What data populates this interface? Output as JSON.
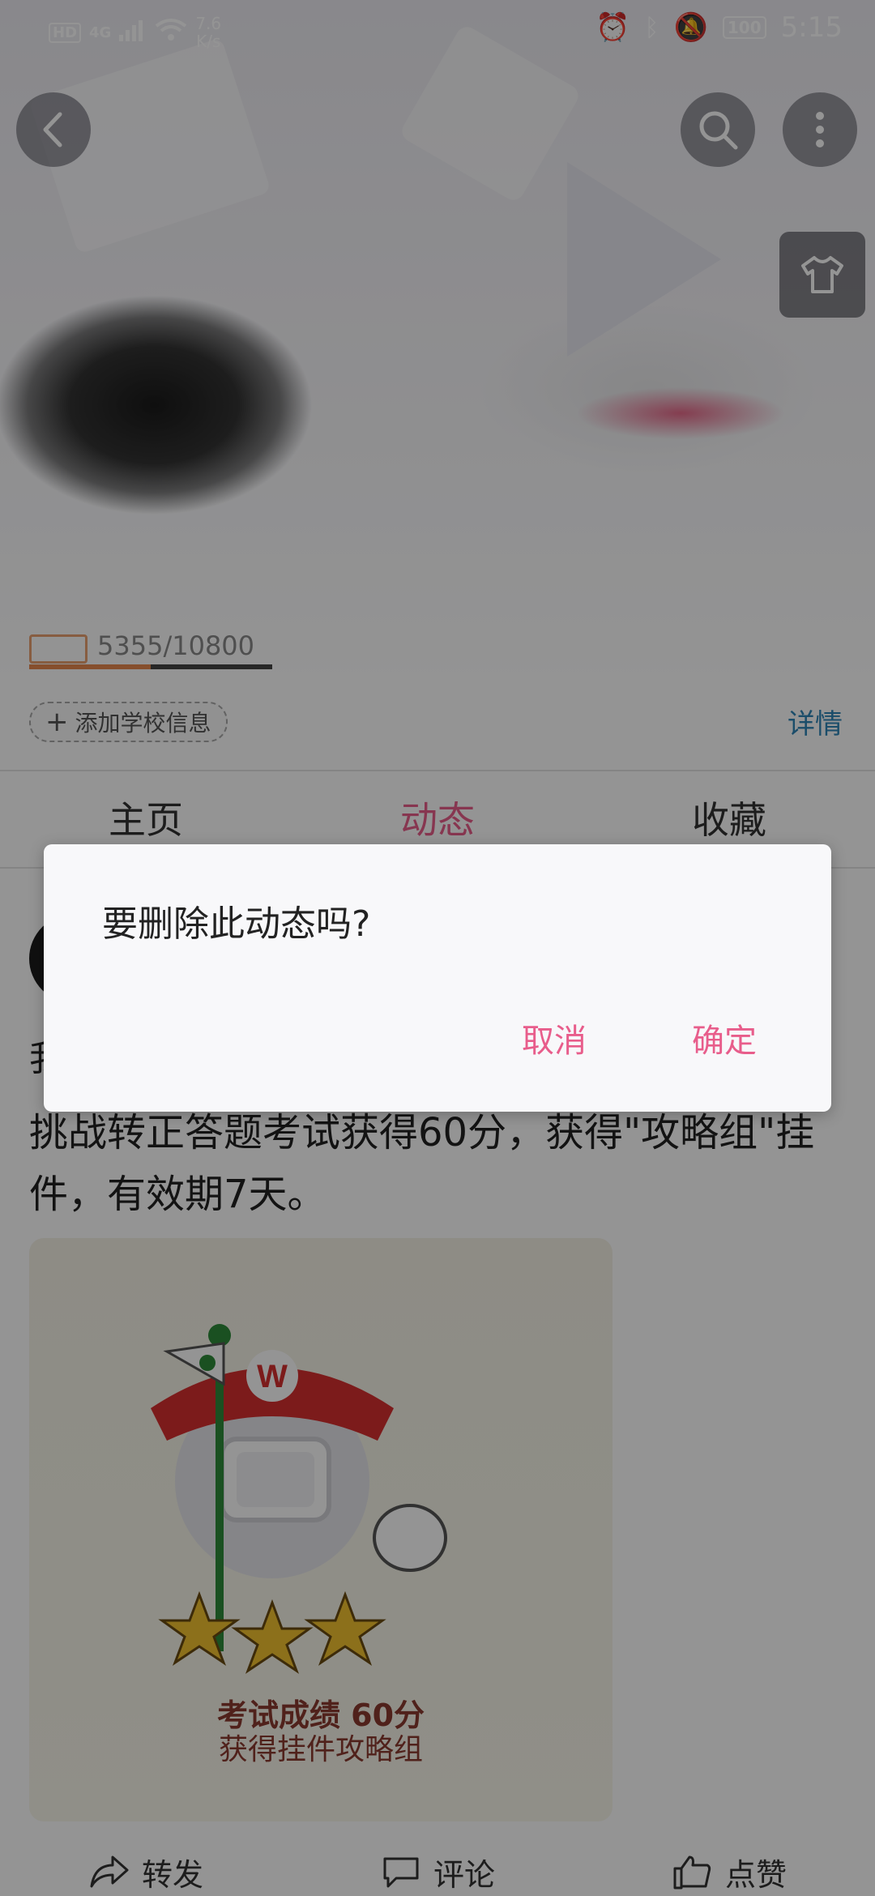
{
  "status_bar": {
    "hd": "HD",
    "network": "4G",
    "speed_value": "7.6",
    "speed_unit": "K/s",
    "battery": "100",
    "time": "5:15"
  },
  "header": {
    "level_progress": "5355/10800",
    "school_chip": "添加学校信息",
    "detail_link": "详情"
  },
  "tabs": [
    {
      "label": "主页",
      "active": false
    },
    {
      "label": "动态",
      "active": true
    },
    {
      "label": "收藏",
      "active": false
    }
  ],
  "post": {
    "first_char": "我",
    "text": "挑战转正答题考试获得60分，获得\"攻略组\"挂件，有效期7天。",
    "card_title": "考试成绩 60分",
    "card_subtitle": "获得挂件攻略组"
  },
  "actions": {
    "share": "转发",
    "comment": "评论",
    "like": "点赞"
  },
  "dialog": {
    "message": "要删除此动态吗?",
    "cancel": "取消",
    "confirm": "确定"
  },
  "colors": {
    "accent": "#e85d8b",
    "link": "#2f86b7"
  }
}
